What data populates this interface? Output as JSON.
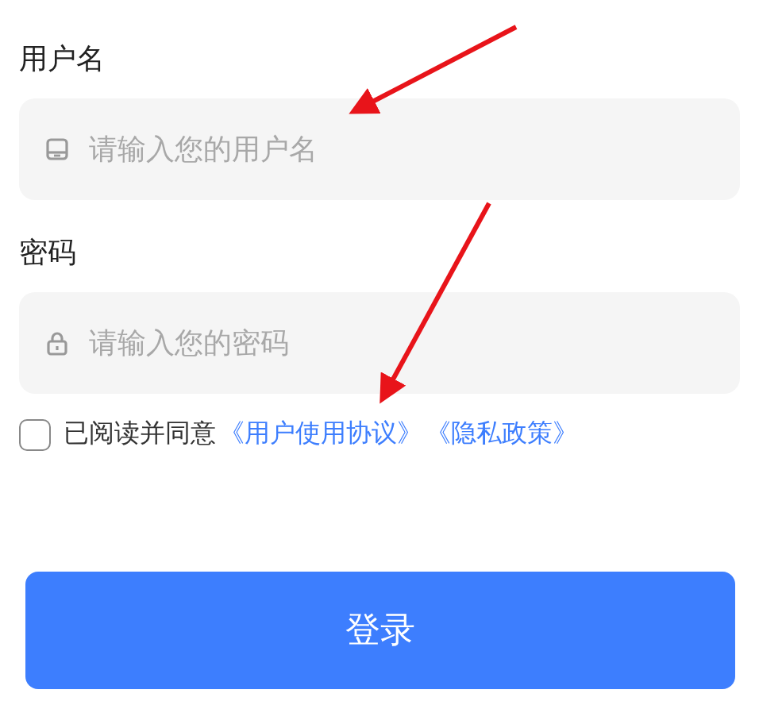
{
  "fields": [
    {
      "label": "用户名",
      "placeholder": "请输入您的用户名",
      "kind": "user"
    },
    {
      "label": "密码",
      "placeholder": "请输入您的密码",
      "kind": "password"
    }
  ],
  "agreement": {
    "checked": false,
    "text": "已阅读并同意",
    "links": [
      "《用户使用协议》",
      "《隐私政策》"
    ]
  },
  "submit": {
    "label": "登录"
  }
}
